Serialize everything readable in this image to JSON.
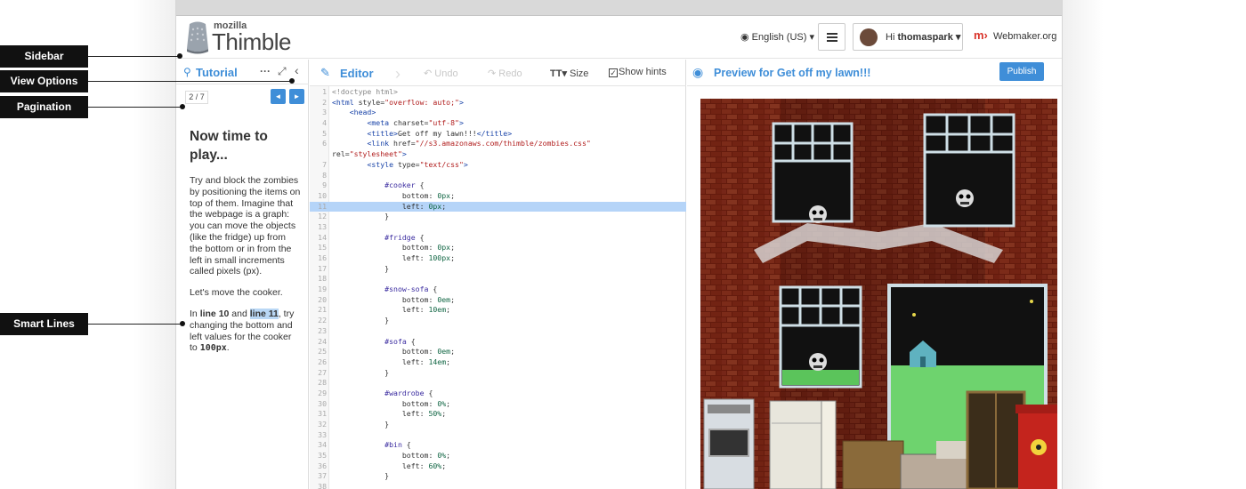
{
  "app": {
    "logo_small": "mozilla",
    "logo_big": "Thimble"
  },
  "header": {
    "language": "English (US) ▾",
    "user_greeting": "Hi",
    "user_name": "thomaspark ▾",
    "webmaker_label": "Webmaker.org"
  },
  "sidebar": {
    "title": "Tutorial",
    "pager": "2 / 7",
    "prev_label": "◄",
    "next_label": "►",
    "heading": "Now time to play...",
    "p1": "Try and block the zombies by positioning the items on top of them. Imagine that the webpage is a graph: you can move the objects (like the fridge) up from the bottom or in from the left in small increments called pixels (px).",
    "p2": "Let's move the cooker.",
    "p3_a": "In ",
    "p3_line10": "line 10",
    "p3_b": " and ",
    "p3_line11": "line 11",
    "p3_c": ", try changing the bottom and left values for the cooker to ",
    "p3_value": "100px",
    "p3_d": "."
  },
  "editor": {
    "title": "Editor",
    "undo": "Undo",
    "redo": "Redo",
    "size": "Size",
    "size_icon": "TT▾",
    "hints": "Show hints",
    "hints_checked": true,
    "active_line": 11,
    "lines": [
      {
        "n": "1",
        "t": "<!doctype html>"
      },
      {
        "n": "2",
        "t": "<html style=\"overflow: auto;\">"
      },
      {
        "n": "3",
        "t": "    <head>"
      },
      {
        "n": "4",
        "t": "        <meta charset=\"utf-8\">"
      },
      {
        "n": "5",
        "t": "        <title>Get off my lawn!!!</title>"
      },
      {
        "n": "6",
        "t": "        <link href=\"//s3.amazonaws.com/thimble/zombies.css\""
      },
      {
        "n": "",
        "t": "rel=\"stylesheet\">"
      },
      {
        "n": "7",
        "t": "        <style type=\"text/css\">"
      },
      {
        "n": "8",
        "t": ""
      },
      {
        "n": "9",
        "t": "            #cooker {"
      },
      {
        "n": "10",
        "t": "                bottom: 0px;"
      },
      {
        "n": "11",
        "t": "                left: 0px;"
      },
      {
        "n": "12",
        "t": "            }"
      },
      {
        "n": "13",
        "t": ""
      },
      {
        "n": "14",
        "t": "            #fridge {"
      },
      {
        "n": "15",
        "t": "                bottom: 0px;"
      },
      {
        "n": "16",
        "t": "                left: 100px;"
      },
      {
        "n": "17",
        "t": "            }"
      },
      {
        "n": "18",
        "t": ""
      },
      {
        "n": "19",
        "t": "            #snow-sofa {"
      },
      {
        "n": "20",
        "t": "                bottom: 0em;"
      },
      {
        "n": "21",
        "t": "                left: 10em;"
      },
      {
        "n": "22",
        "t": "            }"
      },
      {
        "n": "23",
        "t": ""
      },
      {
        "n": "24",
        "t": "            #sofa {"
      },
      {
        "n": "25",
        "t": "                bottom: 0em;"
      },
      {
        "n": "26",
        "t": "                left: 14em;"
      },
      {
        "n": "27",
        "t": "            }"
      },
      {
        "n": "28",
        "t": ""
      },
      {
        "n": "29",
        "t": "            #wardrobe {"
      },
      {
        "n": "30",
        "t": "                bottom: 0%;"
      },
      {
        "n": "31",
        "t": "                left: 50%;"
      },
      {
        "n": "32",
        "t": "            }"
      },
      {
        "n": "33",
        "t": ""
      },
      {
        "n": "34",
        "t": "            #bin {"
      },
      {
        "n": "35",
        "t": "                bottom: 0%;"
      },
      {
        "n": "36",
        "t": "                left: 60%;"
      },
      {
        "n": "37",
        "t": "            }"
      },
      {
        "n": "38",
        "t": ""
      }
    ]
  },
  "preview": {
    "title": "Preview for Get off my lawn!!!",
    "publish": "Publish"
  },
  "annotations": [
    "Sidebar",
    "View Options",
    "Pagination",
    "Smart Lines"
  ],
  "colors": {
    "accent": "#3f8ed8",
    "highlight": "#b5d4f8",
    "annotation_bg": "#111111"
  }
}
